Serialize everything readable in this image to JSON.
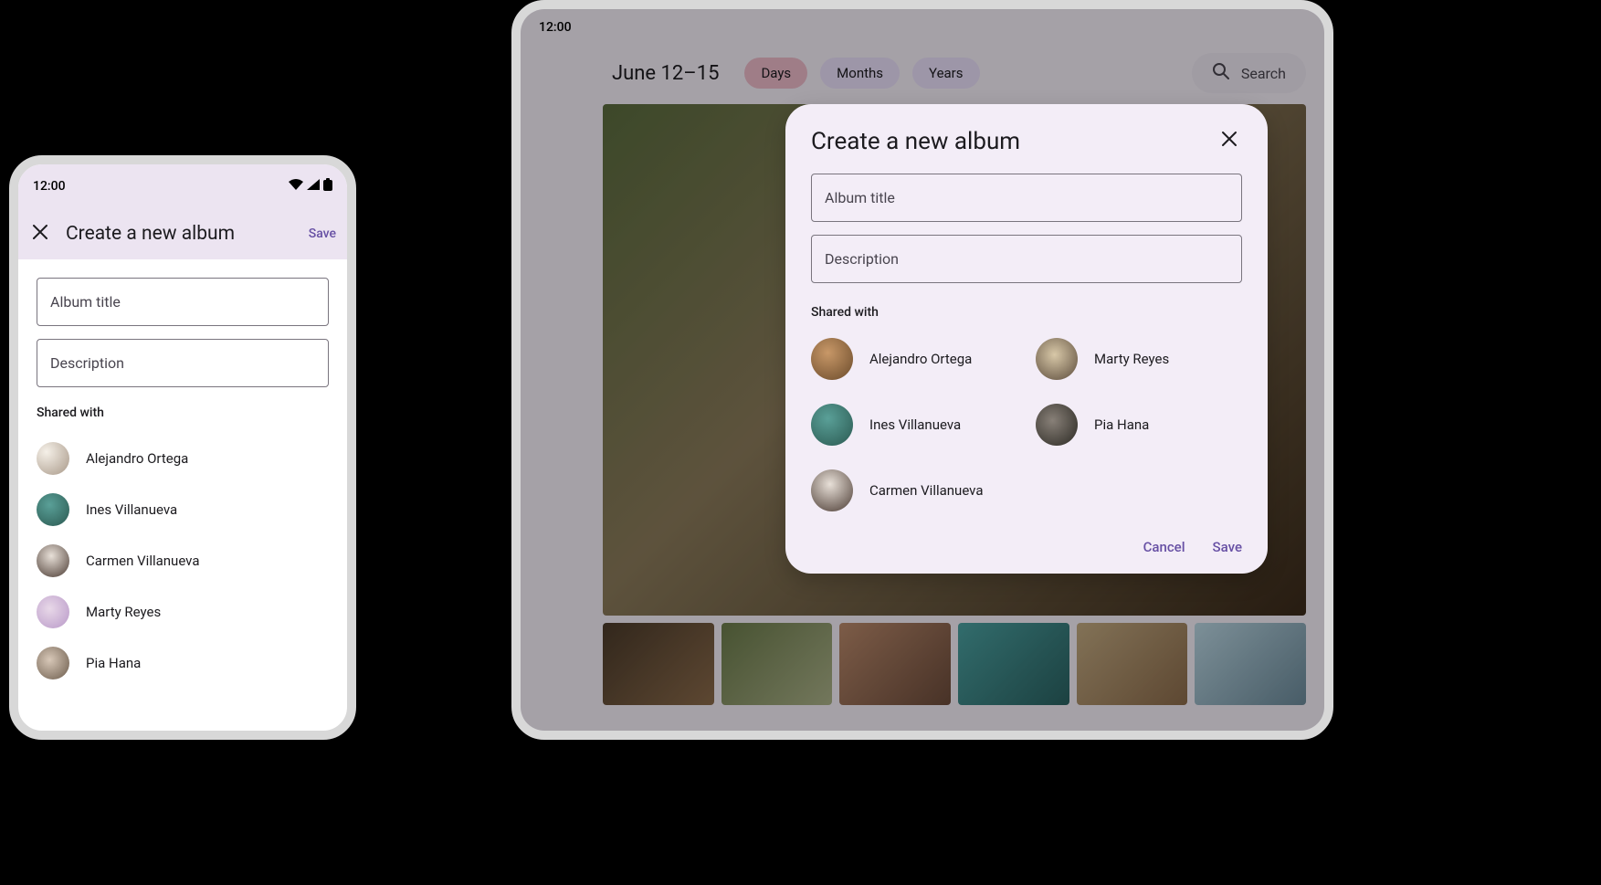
{
  "status_time": "12:00",
  "phone": {
    "title": "Create a new album",
    "save_label": "Save",
    "fields": {
      "title_placeholder": "Album title",
      "description_placeholder": "Description"
    },
    "shared_label": "Shared with",
    "people": [
      {
        "name": "Alejandro Ortega",
        "avatar_class": "av1"
      },
      {
        "name": "Ines Villanueva",
        "avatar_class": "av2"
      },
      {
        "name": "Carmen Villanueva",
        "avatar_class": "av3"
      },
      {
        "name": "Marty Reyes",
        "avatar_class": "av4"
      },
      {
        "name": "Pia Hana",
        "avatar_class": "av5"
      }
    ]
  },
  "tablet": {
    "date_range": "June 12–15",
    "tabs": {
      "days": "Days",
      "months": "Months",
      "years": "Years"
    },
    "search_placeholder": "Search",
    "dialog": {
      "title": "Create a new album",
      "fields": {
        "title_placeholder": "Album title",
        "description_placeholder": "Description"
      },
      "shared_label": "Shared with",
      "people": [
        {
          "name": "Alejandro Ortega",
          "avatar_class": "av6"
        },
        {
          "name": "Marty Reyes",
          "avatar_class": "av7"
        },
        {
          "name": "Ines Villanueva",
          "avatar_class": "av2"
        },
        {
          "name": "Pia Hana",
          "avatar_class": "av8"
        },
        {
          "name": "Carmen Villanueva",
          "avatar_class": "av3"
        }
      ],
      "cancel_label": "Cancel",
      "save_label": "Save"
    }
  }
}
